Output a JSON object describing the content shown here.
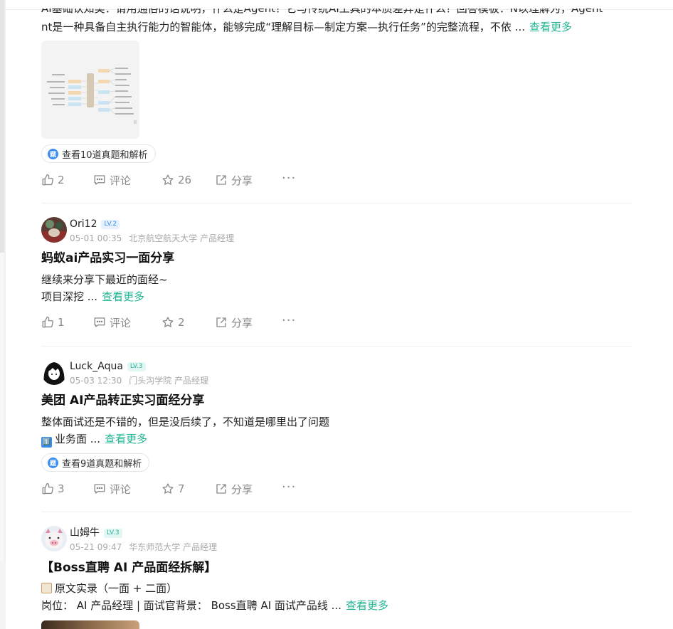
{
  "posts": [
    {
      "body_line1": "AI基础认知类：请用通俗的话说明，什么是Agent？它与传统AI工具的本质差异是什么？回答模板：N以理解为，Agent",
      "body_line2": "nt是一种具备自主执行能力的智能体，能够完成“理解目标—制定方案—执行任务”的完整流程，不依 ...",
      "more": "查看更多",
      "chip": "查看10道真题和解析",
      "likes": "2",
      "comment": "评论",
      "stars": "26",
      "share": "分享"
    },
    {
      "name": "Ori12",
      "level": "LV.2",
      "date": "05-01 00:35",
      "org": "北京航空航天大学 产品经理",
      "title": "蚂蚁ai产品实习一面分享",
      "body_line1": "继续来分享下最近的面经~",
      "body_line2": "项目深挖 ...",
      "more": "查看更多",
      "likes": "1",
      "comment": "评论",
      "stars": "2",
      "share": "分享"
    },
    {
      "name": "Luck_Aqua",
      "level": "LV.3",
      "date": "05-03 12:30",
      "org": "门头沟学院 产品经理",
      "title": "美团 AI产品转正实习面经分享",
      "body_line1": "整体面试还是不错的，但是没后续了，不知道是哪里出了问题",
      "body_line2": "业务面 ...",
      "body_line2_prefix": "1️⃣",
      "more": "查看更多",
      "chip": "查看9道真题和解析",
      "likes": "3",
      "comment": "评论",
      "stars": "7",
      "share": "分享"
    },
    {
      "name": "山姆牛",
      "level": "LV.3",
      "date": "05-21 09:47",
      "org": "华东师范大学 产品经理",
      "title": "【Boss直聘 AI 产品面经拆解】",
      "body_line1": "原文实录（一面 + 二面）",
      "body_line2": "岗位： AI 产品经理 | 面试官背景： Boss直聘 AI 面试产品线 ...",
      "more": "查看更多"
    }
  ],
  "chip_icon_letter": "题",
  "dots": "···",
  "colors": {
    "accent": "#21b693",
    "lv2_bg": "#e6f1fd",
    "lv2_fg": "#3b8ef0",
    "lv3_bg": "#e2f7f3",
    "lv3_fg": "#21b693"
  }
}
